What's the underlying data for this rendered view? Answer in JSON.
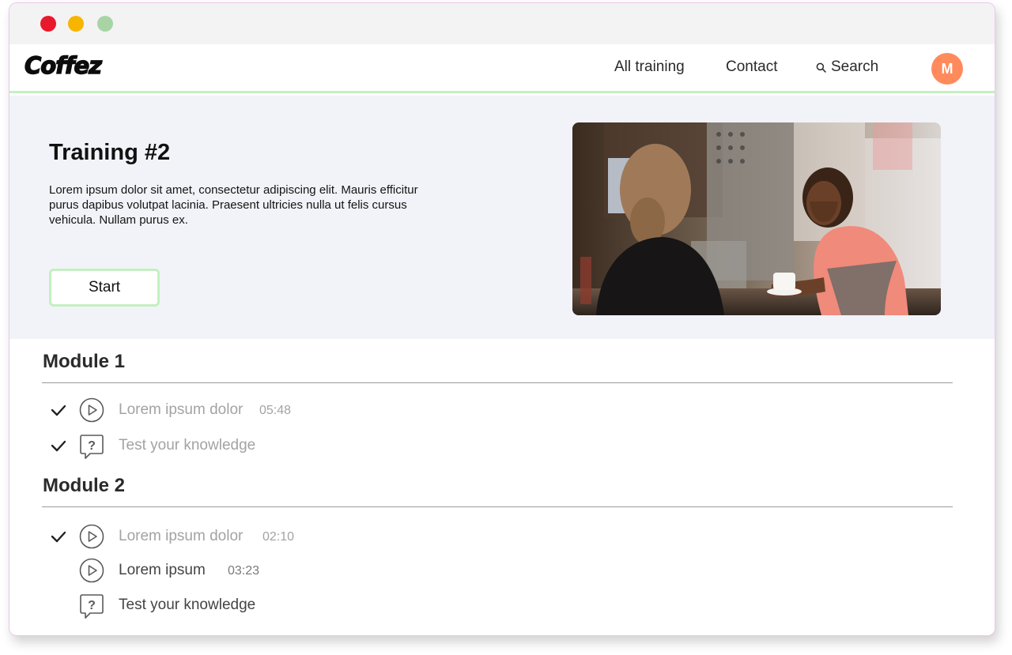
{
  "window": {
    "controls": [
      "close",
      "minimize",
      "maximize"
    ]
  },
  "nav": {
    "logo": "Coffez",
    "links": [
      "All training",
      "Contact"
    ],
    "search_label": "Search",
    "avatar_initial": "M"
  },
  "hero": {
    "title": "Training #2",
    "description": "Lorem ipsum dolor sit amet, consectetur adipiscing elit. Mauris efficitur purus dapibus volutpat lacinia. Praesent ultricies nulla ut felis cursus vehicula. Nullam purus ex.",
    "start_label": "Start"
  },
  "modules": [
    {
      "title": "Module 1",
      "lessons": [
        {
          "type": "video",
          "label": "Lorem ipsum dolor",
          "duration": "05:48",
          "completed": true,
          "icon": "play-icon"
        },
        {
          "type": "quiz",
          "label": "Test your knowledge",
          "completed": true,
          "icon": "question-bubble-icon"
        }
      ]
    },
    {
      "title": "Module 2",
      "lessons": [
        {
          "type": "video",
          "label": "Lorem ipsum dolor",
          "duration": "02:10",
          "completed": true,
          "icon": "play-icon"
        },
        {
          "type": "video",
          "label": "Lorem ipsum",
          "duration": "03:23",
          "completed": false,
          "icon": "play-icon"
        },
        {
          "type": "quiz",
          "label": "Test your knowledge",
          "completed": false,
          "icon": "question-bubble-icon"
        }
      ]
    }
  ],
  "colors": {
    "accent_green": "#c3f0c0",
    "avatar_orange": "#ff8a5c",
    "hero_background": "#f2f3f8",
    "completed_text": "#a3a3a3"
  }
}
